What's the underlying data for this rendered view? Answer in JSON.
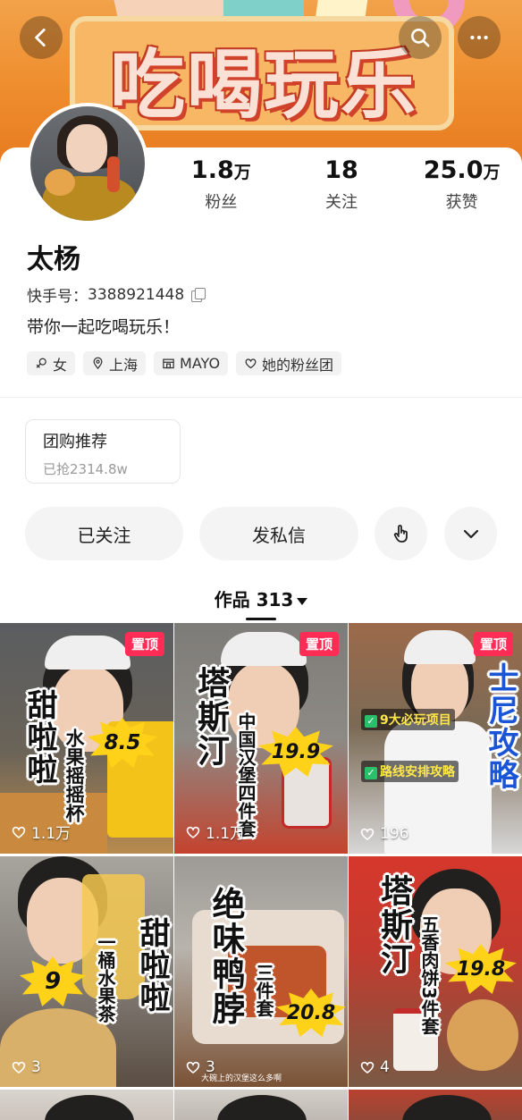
{
  "banner": {
    "title": "吃喝玩乐"
  },
  "profile": {
    "name": "太杨",
    "kuaishou_id_label": "快手号：",
    "kuaishou_id": "3388921448",
    "bio": "带你一起吃喝玩乐！",
    "stats": [
      {
        "num": "1.8",
        "unit": "万",
        "label": "粉丝"
      },
      {
        "num": "18",
        "unit": "",
        "label": "关注"
      },
      {
        "num": "25.0",
        "unit": "万",
        "label": "获赞"
      }
    ],
    "tags": [
      {
        "icon": "female-icon",
        "label": "女"
      },
      {
        "icon": "location-pin-icon",
        "label": "上海"
      },
      {
        "icon": "school-icon",
        "label": "MAYO"
      },
      {
        "icon": "heart-outline-icon",
        "label": "她的粉丝团"
      }
    ]
  },
  "group_buy": {
    "title": "团购推荐",
    "subtitle": "已抢2314.8w"
  },
  "actions": {
    "followed": "已关注",
    "message": "发私信"
  },
  "works": {
    "label": "作品 313"
  },
  "pin_label": "置顶",
  "videos": [
    {
      "title": "甜啦啦",
      "sub": "水果摇摇杯",
      "price": "8.5",
      "likes": "1.1万",
      "pinned": true
    },
    {
      "title": "塔斯汀",
      "sub": "中国汉堡四件套",
      "price": "19.9",
      "likes": "1.1万",
      "pinned": true
    },
    {
      "title": "士尼攻略",
      "check1": "9大必玩项目",
      "check2": "路线安排攻略",
      "likes": "196",
      "pinned": true
    },
    {
      "title": "甜啦啦",
      "sub": "一桶水果茶",
      "price": "9",
      "likes": "3",
      "pinned": false
    },
    {
      "title": "绝味鸭脖",
      "sub": "三件套",
      "price": "20.8",
      "caption": "大碗上的汉堡这么多啊",
      "likes": "3",
      "pinned": false
    },
    {
      "title": "塔斯汀",
      "sub": "五香肉饼3件套",
      "price": "19.8",
      "likes": "4",
      "pinned": false
    }
  ],
  "colors": {
    "accent": "#ff2d55",
    "banner": "#ee8c2c",
    "burst": "#ffd21a"
  }
}
